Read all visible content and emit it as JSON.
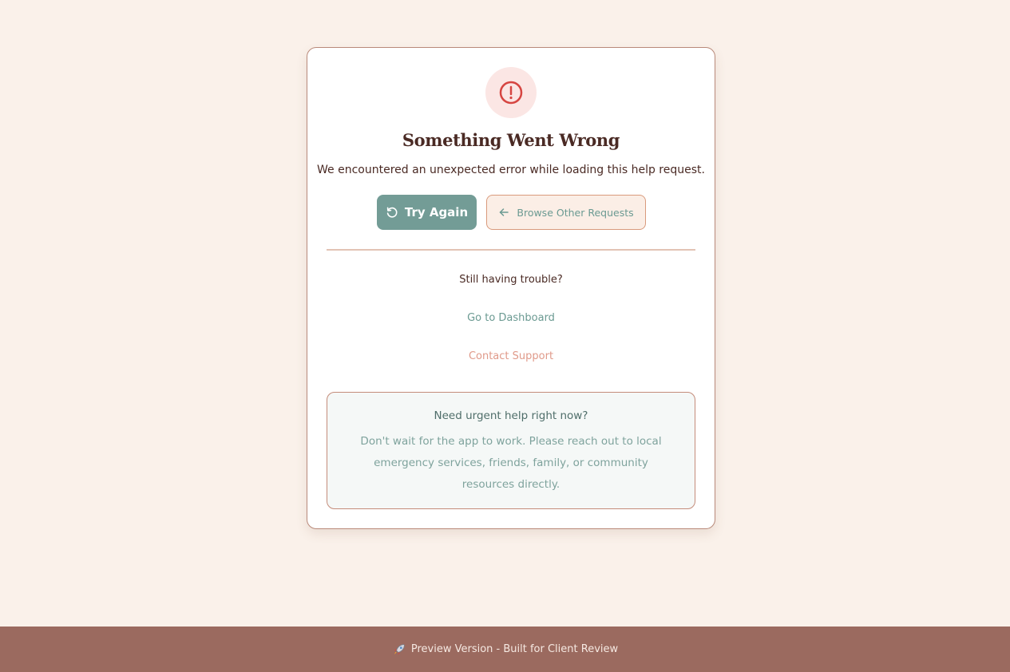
{
  "error": {
    "icon": "alert-circle-icon",
    "title": "Something Went Wrong",
    "message": "We encountered an unexpected error while loading this help request."
  },
  "actions": {
    "retry_label": "Try Again",
    "retry_icon": "refresh-icon",
    "browse_label": "Browse Other Requests",
    "browse_icon": "arrow-left-icon"
  },
  "help": {
    "prompt": "Still having trouble?",
    "dashboard_link": "Go to Dashboard",
    "support_link": "Contact Support"
  },
  "urgent": {
    "title": "Need urgent help right now?",
    "body": "Don't wait for the app to work. Please reach out to local emergency services, friends, family, or community resources directly."
  },
  "footer": {
    "icon": "rocket-icon",
    "text": "Preview Version - Built for Client Review"
  },
  "colors": {
    "background": "#faf1ea",
    "primary": "#739c96",
    "footer": "#9b6a5f",
    "error": "#d64541",
    "text_dark": "#4a2a24"
  }
}
